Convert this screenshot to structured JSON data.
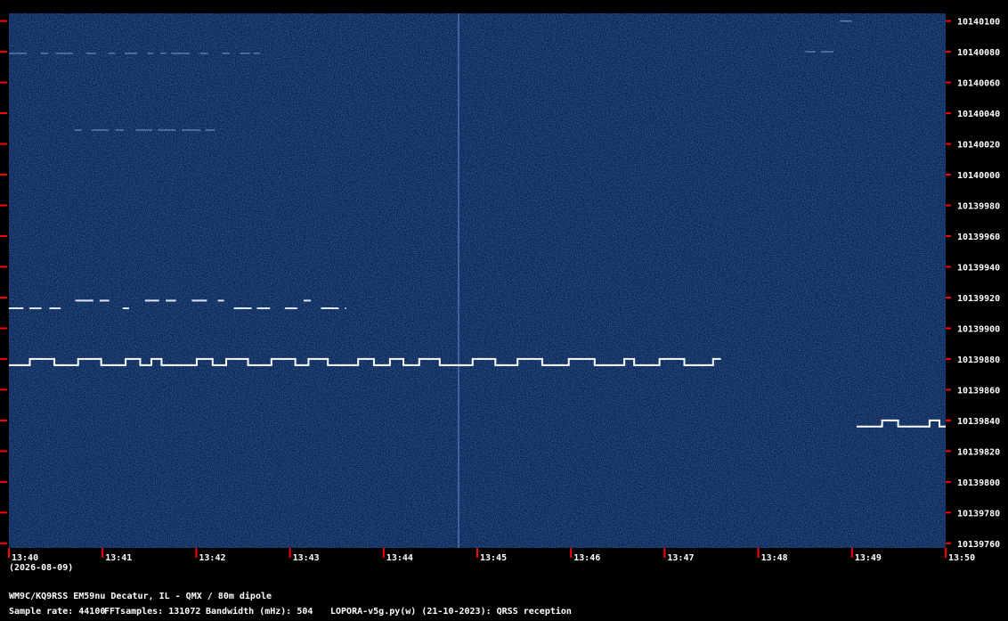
{
  "chart_data": {
    "type": "heatmap",
    "title": "",
    "xlabel": "",
    "ylabel": "",
    "x_tick_labels": [
      "13:40",
      "13:41",
      "13:42",
      "13:43",
      "13:44",
      "13:45",
      "13:46",
      "13:47",
      "13:48",
      "13:49",
      "13:50"
    ],
    "y_tick_labels": [
      "10140100",
      "10140080",
      "10140060",
      "10140040",
      "10140020",
      "10140000",
      "10139980",
      "10139960",
      "10139940",
      "10139920",
      "10139900",
      "10139880",
      "10139860",
      "10139840",
      "10139820",
      "10139800",
      "10139780",
      "10139760"
    ],
    "date_label": "(2026-08-09)",
    "xlim_minutes": [
      0,
      10
    ],
    "ylim_hz": [
      10139757,
      10140105
    ],
    "background_color": "#0a2350",
    "tick_color": "#ff0000",
    "signal_color": "#ffffff",
    "signals": [
      {
        "t_start": 0.0,
        "t_end": 7.6,
        "freq_low": 10139876,
        "freq_high": 10139880,
        "pattern": "FSK-CW square wave"
      },
      {
        "t_start": 0.0,
        "t_end": 3.6,
        "freq_low": 10139913,
        "freq_high": 10139918,
        "pattern": "dotted dashes"
      },
      {
        "t_start": 0.0,
        "t_end": 2.7,
        "freq_low": 10140079,
        "freq_high": 10140079,
        "pattern": "faint dashes"
      },
      {
        "t_start": 0.7,
        "t_end": 2.2,
        "freq_low": 10140029,
        "freq_high": 10140029,
        "pattern": "faint dashes"
      },
      {
        "t_start": 8.5,
        "t_end": 9.0,
        "freq_low": 10140080,
        "freq_high": 10140100,
        "pattern": "faint dashes"
      },
      {
        "t_start": 9.05,
        "t_end": 10.0,
        "freq_low": 10139836,
        "freq_high": 10139840,
        "pattern": "FSK-CW square wave"
      }
    ],
    "vertical_lines": [
      {
        "t": 4.8,
        "pattern": "faint carrier"
      }
    ],
    "footer": {
      "station": "WM9C/KQ9RSS EM59nu Decatur, IL - QMX / 80m dipole",
      "sample_rate": "Sample rate: 44100",
      "fft": "FFTsamples: 131072",
      "bandwidth": "Bandwidth (mHz): 504",
      "software": "LOPORA-v5g.py(w) (21-10-2023): QRSS reception"
    }
  }
}
